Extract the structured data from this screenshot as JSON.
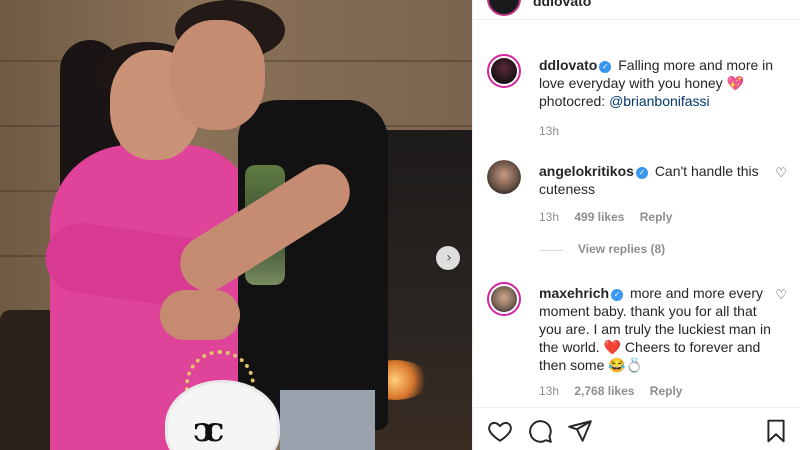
{
  "post": {
    "header_username": "ddlovato",
    "caption": {
      "username": "ddlovato",
      "text": "Falling more and more in love everyday with you honey",
      "emoji": "💖",
      "line2_prefix": "photocred: ",
      "mention": "@brianbonifassi",
      "time": "13h"
    },
    "next_icon": "›"
  },
  "comments": [
    {
      "username": "angelokritikos",
      "text": "Can't handle this cuteness",
      "time": "13h",
      "likes": "499 likes",
      "reply": "Reply",
      "view_replies": "View replies (8)"
    },
    {
      "username": "maxehrich",
      "text": "more and more every moment baby. thank you for all that you are. I am truly the luckiest man in the world.",
      "emoji1": "❤️",
      "text2": "Cheers to forever and then some",
      "emoji2": "😂💍",
      "time": "13h",
      "likes": "2,768 likes",
      "reply": "Reply"
    }
  ],
  "icons": {
    "verified": "✓",
    "heart_outline": "♡"
  },
  "colors": {
    "verified_blue": "#3897f0",
    "mention_blue": "#00376b",
    "story_ring": "#d6249f"
  }
}
